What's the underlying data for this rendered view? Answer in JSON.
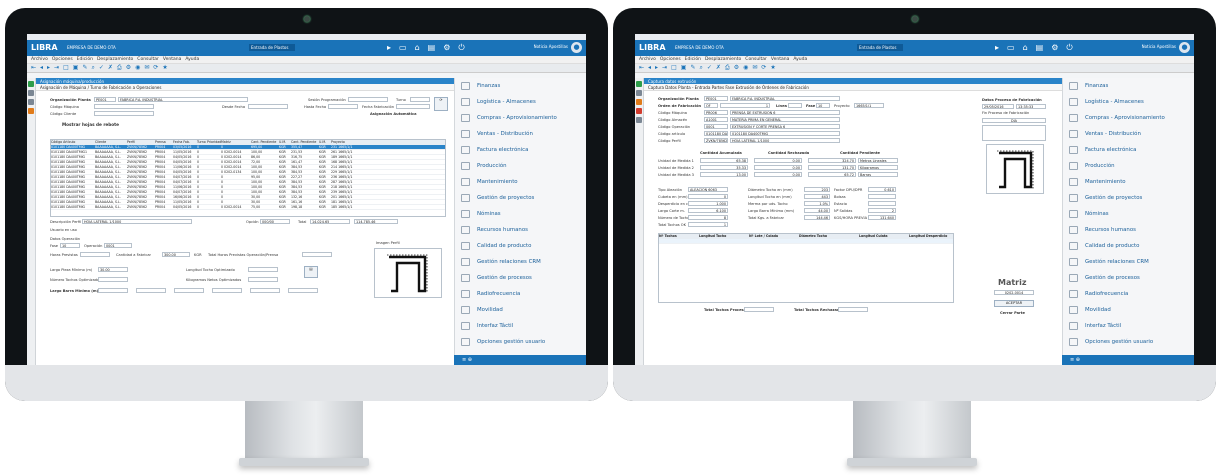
{
  "app": {
    "logo": "LIBRA",
    "company": "EMPRESA DE DEMO OTA",
    "module": "Entrada de Plastos",
    "user": "Noticia Apostillas",
    "user2": "Empresa"
  },
  "menu": [
    "Archivo",
    "Opciones",
    "Edición",
    "Desplazamiento",
    "Consultar",
    "Ventana",
    "Ayuda"
  ],
  "toolbar": [
    "⇤",
    "◂",
    "▸",
    "⇥",
    "□",
    "▣",
    "✎",
    "⌕",
    "✓",
    "✗",
    "⎙",
    "⚙",
    "◉",
    "✉",
    "⟳",
    "★"
  ],
  "right_menu": [
    {
      "label": "Finanzas",
      "icon": "finance-icon"
    },
    {
      "label": "Logística - Almacenes",
      "icon": "warehouse-icon"
    },
    {
      "label": "Compras - Aprovisionamiento",
      "icon": "cart-icon"
    },
    {
      "label": "Ventas - Distribución",
      "icon": "sales-icon"
    },
    {
      "label": "Factura electrónica",
      "icon": "invoice-icon"
    },
    {
      "label": "Producción",
      "icon": "factory-icon"
    },
    {
      "label": "Mantenimiento",
      "icon": "tools-icon"
    },
    {
      "label": "Gestión de proyectos",
      "icon": "project-icon"
    },
    {
      "label": "Nóminas",
      "icon": "payroll-icon"
    },
    {
      "label": "Recursos humanos",
      "icon": "people-icon"
    },
    {
      "label": "Calidad de producto",
      "icon": "quality-icon"
    },
    {
      "label": "Gestión relaciones CRM",
      "icon": "crm-icon"
    },
    {
      "label": "Gestión de procesos",
      "icon": "process-icon"
    },
    {
      "label": "Radiofrecuencia",
      "icon": "radio-icon"
    },
    {
      "label": "Movilidad",
      "icon": "mobile-icon"
    },
    {
      "label": "Interfaz Táctil",
      "icon": "touch-icon"
    },
    {
      "label": "Opciones gestión usuario",
      "icon": "user-icon"
    }
  ],
  "left_screen": {
    "tab": "Asignación máquina/producción",
    "crumb": "Asignación de Máquina / Turno de Fabricación a Operaciones",
    "fields": {
      "org_label": "Organización Planta",
      "org_code": "PE001",
      "org_name": "FABRICA P.A. INDUSTRIAL",
      "sesion_label": "Sesión Programación",
      "turno_label": "Turno",
      "maquina_label": "Código Máquina",
      "desde_label": "Desde Fecha",
      "hasta_label": "Hasta Fecha",
      "fecha_fab_label": "Fecha Fabricación",
      "cliente_label": "Código Cliente",
      "asignacion_label": "Asignación Automática",
      "show_label": "Mostrar hojas de rebote"
    },
    "columns": [
      "Código Artículo",
      "Cliente",
      "Perfil",
      "Prensa",
      "Fecha Fab.",
      "Turno",
      "Prioridad",
      "Matriz",
      "Cant. Pendiente",
      "U.M.",
      "Cant. Pendiente",
      "U.M.",
      "Proyecto"
    ],
    "rows": [
      [
        "0101180 DA400TMIG",
        "BAAAAAAA, S.L.",
        "ZVKN/78562",
        "PR004",
        "03/05/2016",
        "0",
        "",
        "0",
        "695,00",
        "KGR",
        "355,47",
        "KGR",
        "231 1665/1/1"
      ],
      [
        "0101180 DA400TMIG1",
        "BAAAAAAA, S.L.",
        "ZVKN/78562",
        "PR004",
        "11/05/2016",
        "0",
        "",
        "0 0202-0014",
        "100,00",
        "KGR",
        "231,53",
        "KGR",
        "261 1665/1/1"
      ],
      [
        "0101180 DA400TMIG",
        "BAAAAAAA, S.L.",
        "ZVKN/78562",
        "PR004",
        "04/05/2016",
        "0",
        "",
        "0 0202-0014",
        "86,00",
        "KGR",
        "316,75",
        "KGR",
        "189 1665/1/1"
      ],
      [
        "0101180 DA400TMIG",
        "BAAAAAAA, S.L.",
        "ZVKN/78562",
        "PR004",
        "04/05/2016",
        "0",
        "",
        "0 0202-0014",
        "72,00",
        "KGR",
        "161,47",
        "KGR",
        "168 1665/1/1"
      ],
      [
        "0101180 DA400TMIG",
        "BAAAAAAA, S.L.",
        "ZVKN/78562",
        "PR004",
        "11/06/2016",
        "0",
        "",
        "0 0202-0014",
        "100,00",
        "KGR",
        "384,53",
        "KGR",
        "214 1665/1/1"
      ],
      [
        "0101180 DA400TMIG",
        "BAAAAAAA, S.L.",
        "ZVKN/78562",
        "PR004",
        "04/05/2016",
        "0",
        "",
        "0 0202-0134",
        "100,00",
        "KGR",
        "384,53",
        "KGR",
        "229 1665/1/1"
      ],
      [
        "0101180 DA400TMIG",
        "BAAAAAAA, S.L.",
        "ZVKN/78562",
        "PR004",
        "04/07/2016",
        "0",
        "",
        "0",
        "95,00",
        "KGR",
        "227,27",
        "KGR",
        "236 1665/1/1"
      ],
      [
        "0101180 DA400TMIG",
        "BAAAAAAA, S.L.",
        "ZVKN/78562",
        "PR004",
        "04/07/2016",
        "0",
        "",
        "0",
        "100,00",
        "KGR",
        "384,53",
        "KGR",
        "287 1665/1/1"
      ],
      [
        "0101180 DA400TMIG",
        "BAAAAAAA, S.L.",
        "ZVKN/78562",
        "PR004",
        "11/06/2016",
        "0",
        "",
        "0",
        "100,00",
        "KGR",
        "384,53",
        "KGR",
        "218 1665/1/1"
      ],
      [
        "0101180 DA400TMIG",
        "BAAAAAAA, S.L.",
        "ZVKN/78562",
        "PR004",
        "04/07/2016",
        "0",
        "",
        "0",
        "100,00",
        "KGR",
        "384,53",
        "KGR",
        "239 1665/1/1"
      ],
      [
        "0101180 DA400TMIG",
        "BAAAAAAA, S.L.",
        "ZVKN/78562",
        "PR004",
        "16/06/2016",
        "0",
        "",
        "0",
        "30,00",
        "KGR",
        "132,16",
        "KGR",
        "201 1665/1/1"
      ],
      [
        "0101180 DA400TMIG",
        "BAAAAAAA, S.L.",
        "ZVKN/78562",
        "PR004",
        "11/05/2016",
        "0",
        "",
        "0",
        "30,00",
        "KGR",
        "161,16",
        "KGR",
        "181 1665/1/1"
      ],
      [
        "0101180 DA400TMIG",
        "BAAAAAAA, S.L.",
        "ZVKN/78562",
        "PR004",
        "04/05/2016",
        "0",
        "",
        "0 0202-0014",
        "75,00",
        "KGR",
        "198,18",
        "KGR",
        "185 1665/1/1"
      ]
    ],
    "footer": {
      "desc_label": "Descripción Perfil",
      "desc_value": "HOJA LATERAL 1/1000",
      "opcion_label": "Opción",
      "opcion_value": "000/00",
      "total_label": "Total",
      "total1": "14.024,65",
      "total2": "114.785,46"
    },
    "lower": {
      "usuario_label": "Usuario en uso",
      "datos_label": "Datos Operación",
      "fase_label": "Fase",
      "fase_value": "10",
      "operacion_label": "Operación",
      "operacion_value": "0001",
      "horas_label": "Horas Previstas",
      "cantidad_label": "Cantidad a Fabricar",
      "cantidad_value": "300,00",
      "um": "KGR",
      "total_horas_label": "Total Horas Previstas Operación/Prensa",
      "largo_label": "Largo Pieza Mínimo (m)",
      "largo_value": "30,00",
      "long_label": "Longitud Tocho Optimizado",
      "num_label": "Número Tochos Optimizados",
      "kilos_label": "Kilogramos Netos Optimizados",
      "barra_label": "Largo Barra Mínimo (m)",
      "imagen_label": "Imagen Perfil"
    }
  },
  "right_screen": {
    "tab": "Captura datos extrusión",
    "crumb": "Captura Datos Planta - Entrada Partes Fase Extrusión de Órdenes de Fabricación",
    "fields": {
      "org_label": "Organización Planta",
      "org_code": "PE001",
      "org_name": "FABRICA P.A. INDUSTRIAL",
      "orden_label": "Orden de Fabricación",
      "orden_value": "OF",
      "orden_num": "1",
      "linea_label": "Línea",
      "fase_label": "Fase",
      "fase_value": "10",
      "proyecto_label": "Proyecto",
      "proyecto_value": "1665/1/1",
      "maquina_label": "Código Máquina",
      "maquina_code": "PR006",
      "maquina_name": "PRENSA DE EXTRUSIÓN 6",
      "almacen_label": "Código Almacén",
      "almacen_code": "A1001",
      "almacen_name": "MATERIA PRIMA EN GENERAL",
      "operacion_label": "Código Operación",
      "operacion_code": "0001",
      "operacion_name": "EXTRUSIÓN Y CORTE PRENSA 6",
      "articulo_label": "Código artículo",
      "articulo_code": "0101180 DA400TMIG",
      "articulo_name": "0101180 DA400TMIG",
      "perfil_label": "Código Perfil",
      "perfil_code": "ZVKN/78562",
      "perfil_name": "HOJA LATERAL 1/1000"
    },
    "qty": {
      "acumulada_label": "Cantidad Acumulada",
      "rechazada_label": "Cantidad Rechazada",
      "pendiente_label": "Cantidad Pendiente",
      "um1_label": "Unidad de Medida 1",
      "um1_acum": "65,38",
      "um1_rech": "0,00",
      "um1_pend": "324,70",
      "um1_unit": "Metros Lineales",
      "um2_label": "Unidad de Medida 2",
      "um2_acum": "35,33",
      "um2_rech": "0,00",
      "um2_pend": "131,70",
      "um2_unit": "Kilogramos",
      "um3_label": "Unidad de Medida 3",
      "um3_acum": "13,00",
      "um3_rech": "0,00",
      "um3_pend": "65,72",
      "um3_unit": "Barras"
    },
    "params": {
      "aleacion_label": "Tipo Aleación",
      "aleacion_value": "ALEACIÓN 6063",
      "diam_tocho_label": "Diámetro Tocho en (mm)",
      "diam_tocho_value": "203",
      "factor_label": "Factor DPU/DPR",
      "factor_value": "0,610",
      "cubeta_label": "Cubeta en (mm)",
      "cubeta_value": "0",
      "long_tocho_label": "Longitud Tocho en (mm)",
      "long_tocho_value": "443",
      "bolsas_label": "Bolsas",
      "desperdicio_label": "Desperdicio en cm.",
      "desperdicio_value": "1,000",
      "merma_label": "Merma por uds. Tocho",
      "merma_value": "1,0%",
      "estacio_label": "Estacio",
      "corte_label": "Largo Corte m.",
      "corte_value": "6,100",
      "barra_label": "Largo Barra Mínimo (mm)",
      "barra_value": "44,00",
      "salidas_label": "Nº Salidas",
      "salidas_value": "2",
      "tochos_label": "Número de Tochos",
      "tochos_value": "8",
      "kilos_label": "Total Kgs. a Fabricar",
      "kilos_value": "144,46",
      "kgs_label": "KGS/HORA PREVIA",
      "kgs_value": "131,640",
      "tochos_ok_label": "Total Tochos OK",
      "tochos_ok_value": "1"
    },
    "grid_columns": [
      "Nº Tochos",
      "Longitud Tocho",
      "Nº Lote / Colada",
      "Diámetro Tocho",
      "Longitud Culata",
      "Longitud Desperdicio"
    ],
    "totals": {
      "procesados_label": "Total Tochos Procesados",
      "rechazados_label": "Total Tochos Rechazados"
    },
    "side": {
      "datos_label": "Datos Proceso de Fabricación",
      "fecha": "29/05/2016",
      "hora": "13:35:33",
      "periodo_label": "Fin Proceso de Fabricación",
      "turno": "DIA",
      "matriz_label": "Matriz",
      "matriz_value": "0202-0014",
      "aceptar": "ACEPTAR",
      "cerrar": "Cerrar Parte"
    }
  },
  "colors": {
    "brand": "#1a73b8",
    "tab": "#2a84c9",
    "menu_text": "#1a5f99"
  }
}
